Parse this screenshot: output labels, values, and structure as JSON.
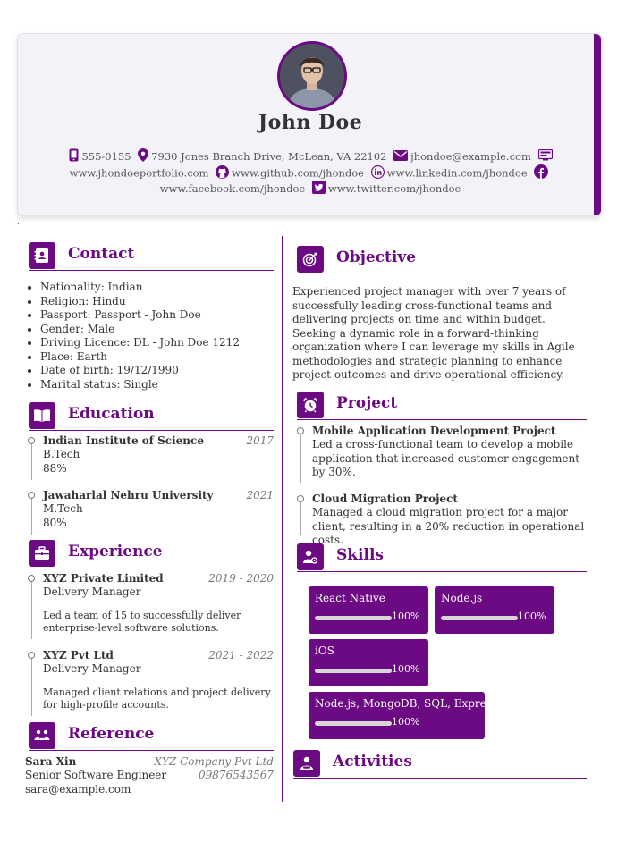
{
  "header": {
    "name": "John Doe",
    "phone": "555-0155",
    "address": "7930 Jones Branch Drive, McLean, VA 22102",
    "email": "jhondoe@example.com",
    "portfolio": "www.jhondoeportfolio.com",
    "github": "www.github.com/jhondoe",
    "linkedin": "www.linkedin.com/jhondoe",
    "facebook": "www.facebook.com/jhondoe",
    "twitter": "www.twitter.com/jhondoe"
  },
  "contact": {
    "title": "Contact",
    "items": [
      "Nationality: Indian",
      "Religion: Hindu",
      "Passport: Passport - John Doe",
      "Gender: Male",
      "Driving Licence: DL - John Doe 1212",
      "Place: Earth",
      "Date of birth: 19/12/1990",
      "Marital status: Single"
    ]
  },
  "education": {
    "title": "Education",
    "items": [
      {
        "school": "Indian Institute of Science",
        "year": "2017",
        "degree": "B.Tech",
        "score": "88%"
      },
      {
        "school": "Jawaharlal Nehru University",
        "year": "2021",
        "degree": "M.Tech",
        "score": "80%"
      }
    ]
  },
  "experience": {
    "title": "Experience",
    "items": [
      {
        "company": "XYZ Private Limited",
        "dates": "2019 - 2020",
        "role": "Delivery Manager",
        "desc": "Led a team of 15 to successfully deliver enterprise-level software solutions."
      },
      {
        "company": "XYZ Pvt Ltd",
        "dates": "2021 - 2022",
        "role": "Delivery Manager",
        "desc": "Managed client relations and project delivery for high-profile accounts."
      }
    ]
  },
  "reference": {
    "title": "Reference",
    "name": "Sara Xin",
    "company": "XYZ Company Pvt Ltd",
    "role": "Senior Software Engineer",
    "phone": "09876543567",
    "email": "sara@example.com"
  },
  "objective": {
    "title": "Objective",
    "text": "Experienced project manager with over 7 years of successfully leading cross-functional teams and delivering projects on time and within budget. Seeking a dynamic role in a forward-thinking organization where I can leverage my skills in Agile methodologies and strategic planning to enhance project outcomes and drive operational efficiency."
  },
  "project": {
    "title": "Project",
    "items": [
      {
        "name": "Mobile Application Development Project",
        "desc": "Led a cross-functional team to develop a mobile application that increased customer engagement by 30%."
      },
      {
        "name": "Cloud Migration Project",
        "desc": "Managed a cloud migration project for a major client, resulting in a 20% reduction in operational costs."
      }
    ]
  },
  "skills": {
    "title": "Skills",
    "items": [
      {
        "name": "React Native",
        "level": "100%",
        "fraction": 1.0
      },
      {
        "name": "Node.js",
        "level": "100%",
        "fraction": 1.0
      },
      {
        "name": "iOS",
        "level": "100%",
        "fraction": 1.0
      },
      {
        "name": "Node.js, MongoDB, SQL, Express",
        "level": "100%",
        "fraction": 1.0
      }
    ]
  },
  "activities": {
    "title": "Activities"
  },
  "colors": {
    "accent": "#6b0a83",
    "text": "#333333",
    "muted": "#777777",
    "header_bg": "#f3f2f9"
  },
  "icons": {
    "contact": "address-book-icon",
    "education": "book-open-icon",
    "experience": "briefcase-icon",
    "reference": "handshake-icon",
    "objective": "target-icon",
    "project": "alarm-clock-icon",
    "skills": "user-gear-icon",
    "activities": "user-activity-icon"
  }
}
